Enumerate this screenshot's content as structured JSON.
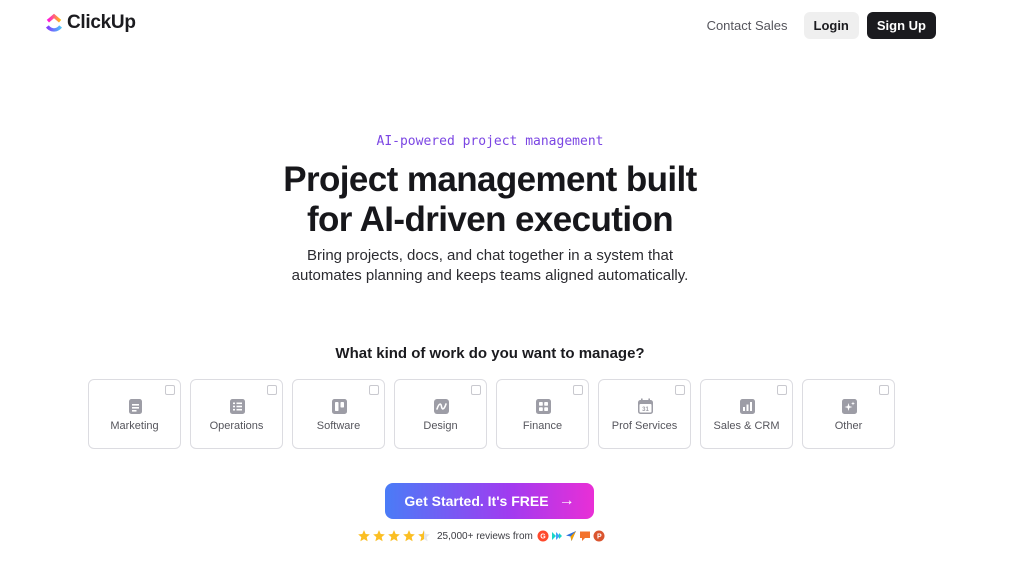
{
  "brand": {
    "name": "ClickUp",
    "colors": {
      "blue": "#4a7cf7",
      "purple": "#7b46e3",
      "pink": "#e92fd6",
      "orange": "#f3722c"
    }
  },
  "nav": {
    "contact": "Contact Sales",
    "login": "Login",
    "signup": "Sign Up"
  },
  "hero": {
    "eyebrow": "AI-powered project management",
    "title_line1": "Project management built",
    "title_line2": "for AI-driven execution",
    "sub_line1": "Bring projects, docs, and chat together in a system that",
    "sub_line2": "automates planning and keeps teams aligned automatically."
  },
  "work": {
    "question": "What kind of work do you want to manage?",
    "options": [
      {
        "label": "Marketing",
        "icon": "document-icon"
      },
      {
        "label": "Operations",
        "icon": "list-icon"
      },
      {
        "label": "Software",
        "icon": "board-icon"
      },
      {
        "label": "Design",
        "icon": "design-icon"
      },
      {
        "label": "Finance",
        "icon": "grid-icon"
      },
      {
        "label": "Prof Services",
        "icon": "calendar-icon",
        "icon_text": "31"
      },
      {
        "label": "Sales & CRM",
        "icon": "bar-chart-icon"
      },
      {
        "label": "Other",
        "icon": "sparkle-icon"
      }
    ]
  },
  "cta": {
    "label": "Get Started. It's FREE",
    "arrow": "→"
  },
  "reviews": {
    "rating": 4.5,
    "text": "25,000+ reviews from",
    "sources": [
      "g2-icon",
      "capterra-icon",
      "getapp-icon",
      "trustradius-icon",
      "producthunt-icon"
    ]
  }
}
